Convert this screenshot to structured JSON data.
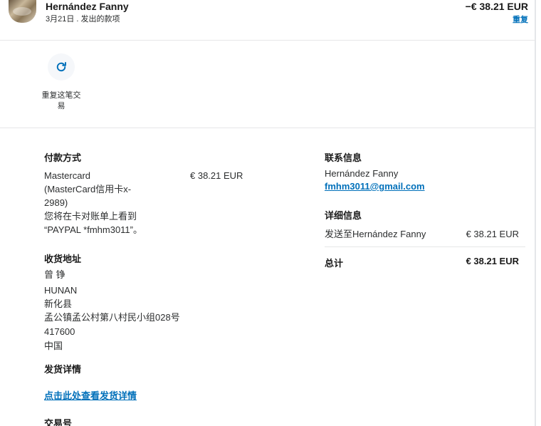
{
  "header": {
    "payee_name": "Hernández Fanny",
    "subline": "3月21日 . 发出的款项",
    "amount": "−€ 38.21 EUR",
    "repeat_link": "重复"
  },
  "actions": {
    "repeat_label": "重复这笔交易"
  },
  "payment": {
    "title": "付款方式",
    "method_lines": [
      "Mastercard",
      "(MasterCard信用卡x-",
      "2989)",
      "您将在卡对账单上看到",
      "“PAYPAL *fmhm3011”。"
    ],
    "amount": "€ 38.21 EUR"
  },
  "shipping_address": {
    "title": "收货地址",
    "lines": [
      "曾 铮",
      "HUNAN",
      "新化县",
      "孟公镇孟公村第八村民小组028号",
      "417600",
      "中国"
    ]
  },
  "shipping_details": {
    "title": "发货详情",
    "link": "点击此处查看发货详情"
  },
  "transaction_id": {
    "title": "交易号"
  },
  "contact": {
    "title": "联系信息",
    "name": "Hernández Fanny",
    "email": "fmhm3011@gmail.com"
  },
  "details": {
    "title": "详细信息",
    "line_label": "发送至Hernández Fanny",
    "line_amount": "€ 38.21 EUR",
    "total_label": "总计",
    "total_amount": "€ 38.21 EUR"
  },
  "icons": {
    "repeat": "refresh-icon"
  },
  "colors": {
    "link": "#0070ba",
    "text": "#2c2e2f",
    "divider": "#e6e7e8"
  }
}
